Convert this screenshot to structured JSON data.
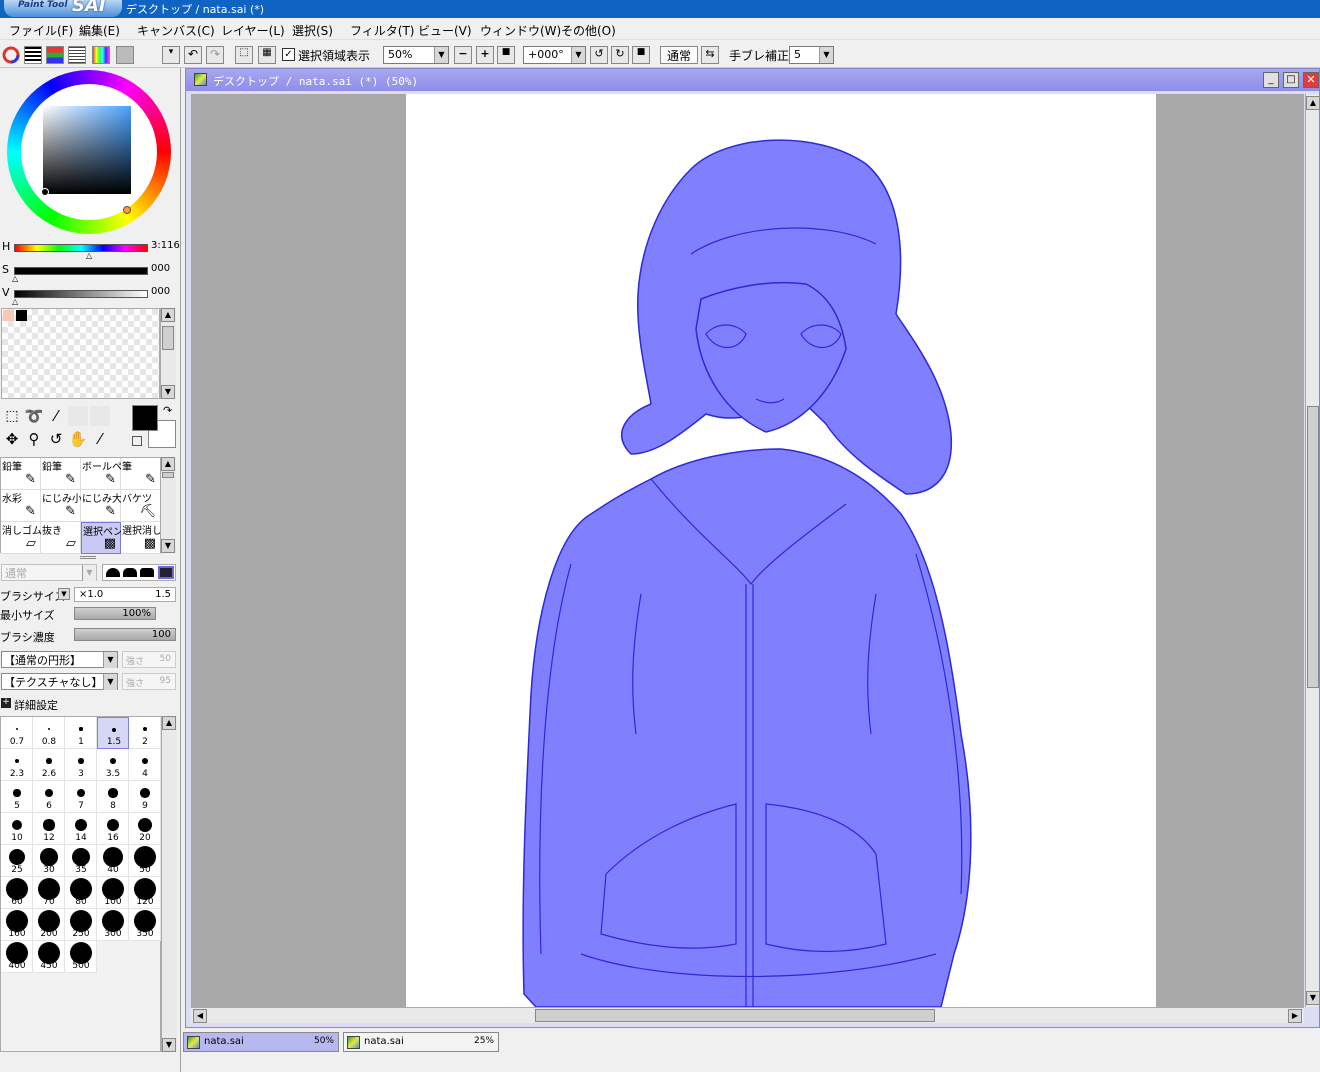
{
  "app": {
    "logo_small": "Paint Tool",
    "logo_big": "SAI",
    "window_title": "デスクトップ / nata.sai (*)"
  },
  "menu": [
    "ファイル(F)",
    "編集(E)",
    "キャンバス(C)",
    "レイヤー(L)",
    "選択(S)",
    "フィルタ(T)",
    "ビュー(V)",
    "ウィンドウ(W)",
    "その他(O)"
  ],
  "toolbar": {
    "selection_checkbox_label": "選択領域表示",
    "selection_checked": true,
    "zoom": "50%",
    "rotation": "+000°",
    "blend_mode": "通常",
    "stabilizer_label": "手ブレ補正",
    "stabilizer_value": "5"
  },
  "color": {
    "h_label": "H",
    "h_value": "3:116",
    "s_label": "S",
    "s_value": "000",
    "v_label": "V",
    "v_value": "000",
    "fg": "#000000",
    "bg": "#ffffff",
    "hue_square": "#4aa0ff",
    "swatches": [
      "#f6c9b0",
      "#000000"
    ]
  },
  "tools": {
    "row1": [
      "selection-rect-icon",
      "lasso-icon",
      "magic-wand-icon"
    ],
    "row2": [
      "move-icon",
      "zoom-icon",
      "rotate-icon",
      "hand-icon",
      "eyedropper-icon"
    ]
  },
  "brushes": [
    {
      "label": "鉛筆",
      "icon": "✎"
    },
    {
      "label": "鉛筆",
      "icon": "✎"
    },
    {
      "label": "ボールペン",
      "icon": "✎"
    },
    {
      "label": "筆",
      "icon": "✎"
    },
    {
      "label": "水彩",
      "icon": "✎"
    },
    {
      "label": "にじみ小",
      "icon": "✎"
    },
    {
      "label": "にじみ大",
      "icon": "✎"
    },
    {
      "label": "バケツ",
      "icon": "⛏"
    },
    {
      "label": "消しゴム",
      "icon": "▱"
    },
    {
      "label": "抜き",
      "icon": "▱"
    },
    {
      "label": "選択ペン",
      "icon": "▩"
    },
    {
      "label": "選択消し",
      "icon": "▩"
    }
  ],
  "brush_props": {
    "blend_mode": "通常",
    "brush_size_label": "ブラシサイズ",
    "size_mult": "×1.0",
    "size_value": "1.5",
    "min_size_label": "最小サイズ",
    "min_size_value": "100%",
    "density_label": "ブラシ濃度",
    "density_value": "100",
    "shape": "【通常の円形】",
    "shape_strength_label": "強さ",
    "shape_strength": "50",
    "texture": "【テクスチャなし】",
    "texture_strength_label": "強さ",
    "texture_strength": "95",
    "advanced_label": "詳細設定",
    "sizes": [
      "0.7",
      "0.8",
      "1",
      "1.5",
      "2",
      "2.3",
      "2.6",
      "3",
      "3.5",
      "4",
      "5",
      "6",
      "7",
      "8",
      "9",
      "10",
      "12",
      "14",
      "16",
      "20",
      "25",
      "30",
      "35",
      "40",
      "50",
      "60",
      "70",
      "80",
      "100",
      "120",
      "160",
      "200",
      "250",
      "300",
      "350",
      "400",
      "450",
      "500"
    ],
    "selected_size": "1.5"
  },
  "document": {
    "title": "デスクトップ / nata.sai (*) (50%)"
  },
  "tabs": [
    {
      "name": "nata.sai",
      "zoom": "50%",
      "active": true
    },
    {
      "name": "nata.sai",
      "zoom": "25%",
      "active": false
    }
  ]
}
